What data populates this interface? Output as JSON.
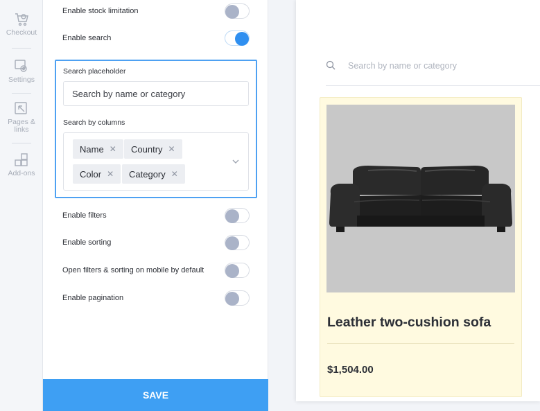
{
  "rail": {
    "items": [
      {
        "label": "Checkout",
        "icon": "checkout-icon"
      },
      {
        "label": "Settings",
        "icon": "settings-icon"
      },
      {
        "label": "Pages &\nlinks",
        "icon": "pages-links-icon"
      },
      {
        "label": "Add-ons",
        "icon": "add-ons-icon"
      }
    ]
  },
  "settings": {
    "stock_limitation": {
      "label": "Enable stock limitation",
      "on": false
    },
    "search": {
      "label": "Enable search",
      "on": true
    },
    "search_placeholder": {
      "label": "Search placeholder",
      "value": "Search by name or category"
    },
    "search_columns": {
      "label": "Search by columns",
      "chips": [
        "Name",
        "Country",
        "Color",
        "Category"
      ],
      "remove_glyph": "✕"
    },
    "filters": {
      "label": "Enable filters",
      "on": false
    },
    "sorting": {
      "label": "Enable sorting",
      "on": false
    },
    "mobile_default": {
      "label": "Open filters & sorting on mobile by default",
      "on": false
    },
    "pagination": {
      "label": "Enable pagination",
      "on": false
    },
    "save_label": "SAVE"
  },
  "preview": {
    "search_placeholder": "Search by name or category",
    "product": {
      "title": "Leather two-cushion sofa",
      "price": "$1,504.00"
    }
  },
  "colors": {
    "accent": "#3e9ff3",
    "toggle_off": "#aab3c8",
    "card_bg": "#fffae0"
  }
}
